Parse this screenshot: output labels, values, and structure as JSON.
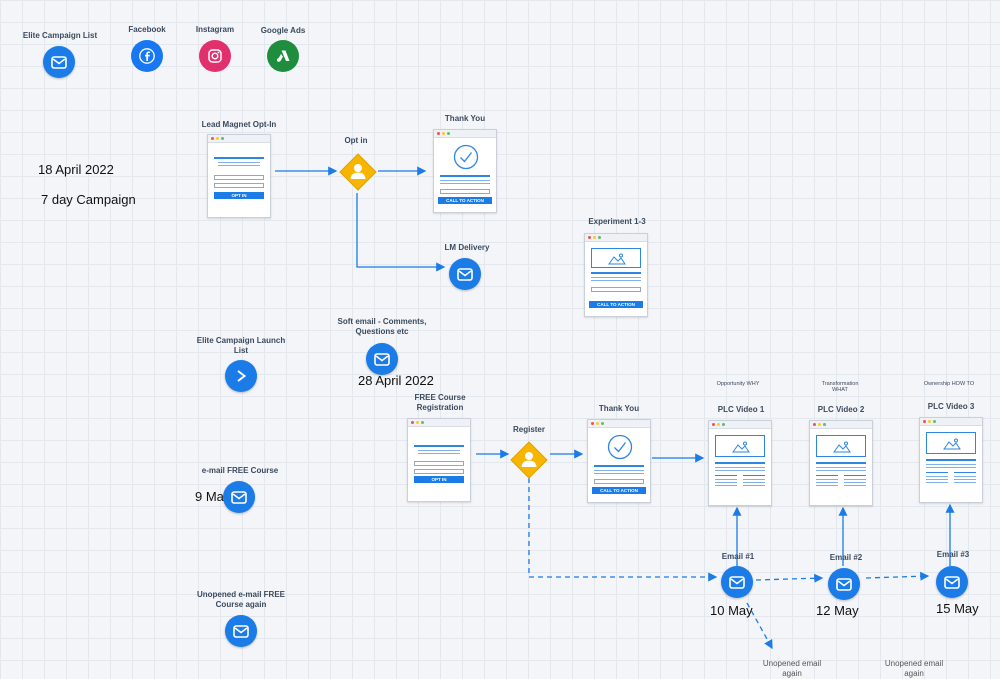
{
  "labels": {
    "elite_list": "Elite Campaign List",
    "facebook": "Facebook",
    "instagram": "Instagram",
    "google_ads": "Google Ads",
    "lead_magnet": "Lead Magnet Opt-In",
    "opt_in": "Opt in",
    "thank_you_1": "Thank You",
    "lm_delivery": "LM Delivery",
    "experiment": "Experiment 1-3",
    "launch_list": "Elite Campaign Launch List",
    "soft_email": "Soft email - Comments, Questions etc",
    "free_course_reg": "FREE Course Registration",
    "register": "Register",
    "thank_you_2": "Thank You",
    "plc1_top": "Opportunity WHY",
    "plc1": "PLC Video 1",
    "plc2_top": "Transformation WHAT",
    "plc2": "PLC Video 2",
    "plc3_top": "Ownership HOW TO",
    "plc3": "PLC Video 3",
    "email_free_course": "e-mail FREE Course",
    "unopened_free": "Unopened e-mail FREE Course again",
    "email1": "Email #1",
    "email2": "Email #2",
    "email3": "Email #3",
    "unopened_bottom": "Unopened email again",
    "bottom_right": "Unopened email again"
  },
  "dates": {
    "start": "18 April 2022",
    "campaign": "7 day Campaign",
    "soft": "28 April 2022",
    "may9": "9 Ma",
    "may10": "10 May",
    "may12": "12 May",
    "may15": "15 May"
  },
  "buttons": {
    "opt_in": "OPT IN",
    "cta": "CALL TO ACTION"
  },
  "colors": {
    "accent": "#1b7be7",
    "decision": "#f7b500",
    "facebook": "#1877f2",
    "instagram": "#e1306c",
    "google_ads": "#1e8e3e"
  },
  "icons": {
    "email": "envelope-icon",
    "decision": "person-diamond-icon",
    "activecampaign": "chevron-right-icon"
  }
}
